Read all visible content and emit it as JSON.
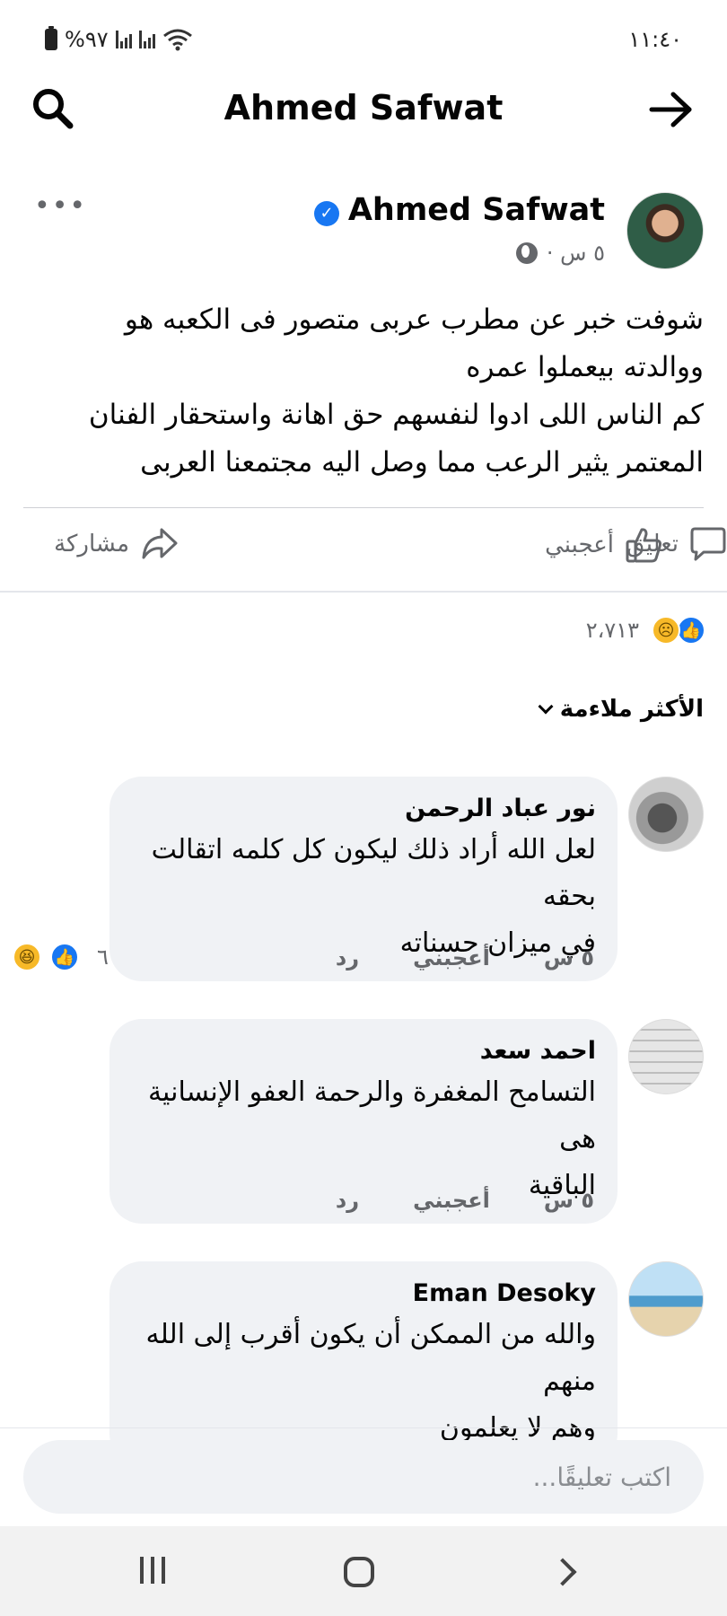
{
  "status_bar": {
    "battery_text": "%٩٧",
    "time": "١١:٤٠"
  },
  "header": {
    "title": "Ahmed Safwat"
  },
  "post": {
    "author": "Ahmed Safwat",
    "time": "٥ س ·",
    "body_lines": [
      "شوفت خبر عن مطرب عربى متصور فى الكعبه هو",
      "ووالدته بيعملوا عمره",
      "كم الناس اللى ادوا لنفسهم حق اهانة واستحقار الفنان",
      "المعتمر يثير الرعب مما وصل اليه مجتمعنا  العربى"
    ],
    "actions": {
      "like": "أعجبني",
      "comment": "تعليق",
      "share": "مشاركة"
    },
    "reactions_count": "٢،٧١٣",
    "sort_label": "الأكثر ملاءمة"
  },
  "comments": [
    {
      "name": "نور عباد الرحمن",
      "text_lines": [
        "لعل الله أراد ذلك ليكون كل كلمه اتقالت بحقه",
        "في ميزان حسناته"
      ],
      "time": "٥ س",
      "like": "أعجبني",
      "reply": "رد",
      "reactions_count": "٦"
    },
    {
      "name": "احمد سعد",
      "text_lines": [
        "التسامح المغفرة والرحمة العفو الإنسانية هى",
        "الباقية"
      ],
      "time": "٥ س",
      "like": "أعجبني",
      "reply": "رد"
    },
    {
      "name": "Eman Desoky",
      "text_lines": [
        "والله من الممكن أن يكون أقرب إلى الله منهم",
        "وهم لا يعلمون"
      ]
    }
  ],
  "composer": {
    "placeholder": "اكتب تعليقًا..."
  }
}
